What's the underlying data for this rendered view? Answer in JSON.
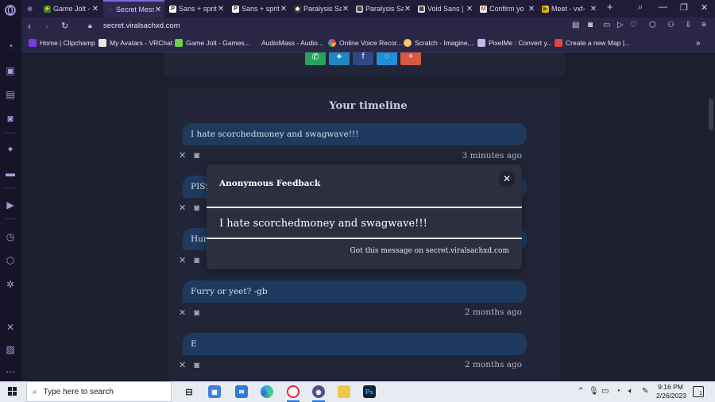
{
  "tabs": [
    {
      "label": "",
      "active": false
    },
    {
      "label": "Game Jolt -",
      "active": false
    },
    {
      "label": "Secret Mess",
      "active": true
    },
    {
      "label": "Sans + sprit",
      "active": false
    },
    {
      "label": "Sans + sprit",
      "active": false
    },
    {
      "label": "Paralysis Sa",
      "active": false
    },
    {
      "label": "Paralysis Sa",
      "active": false
    },
    {
      "label": "Void Sans |",
      "active": false
    },
    {
      "label": "Confirm yo",
      "active": false
    },
    {
      "label": "Meet - vxf-",
      "active": false
    }
  ],
  "address": {
    "url": "secret.viralsachxd.com"
  },
  "bookmarks": [
    {
      "label": "Home | Clipchamp"
    },
    {
      "label": "My Avatars - VRChat"
    },
    {
      "label": "Game Jolt - Games..."
    },
    {
      "label": "AudioMass - Audio..."
    },
    {
      "label": "Online Voice Recor..."
    },
    {
      "label": "Scratch - Imagine,..."
    },
    {
      "label": "PixelMe : Convert y..."
    },
    {
      "label": "Create a new Map |..."
    }
  ],
  "timeline": {
    "title": "Your timeline",
    "messages": [
      {
        "text": "I hate scorchedmoney and swagwave!!!",
        "time": "3 minutes ago"
      },
      {
        "text": "PISS",
        "time": ""
      },
      {
        "text": "Hur",
        "time": ""
      },
      {
        "text": "Furry or yeet? -gb",
        "time": "2 months ago"
      },
      {
        "text": "E",
        "time": "2 months ago"
      }
    ]
  },
  "modal": {
    "title": "Anonymous Feedback",
    "message": "I hate scorchedmoney and swagwave!!!",
    "footer": "Got this message on secret.viralsachxd.com"
  },
  "taskbar": {
    "search_placeholder": "Type here to search",
    "time": "9:16 PM",
    "date": "2/26/2023",
    "notification_count": "1"
  },
  "colors": {
    "page_bg": "#1c1f2e",
    "card_bg": "#222537",
    "bubble_bg": "#1e3a5f",
    "modal_bg": "#2c2f3e",
    "accent": "#7b6cd8"
  }
}
